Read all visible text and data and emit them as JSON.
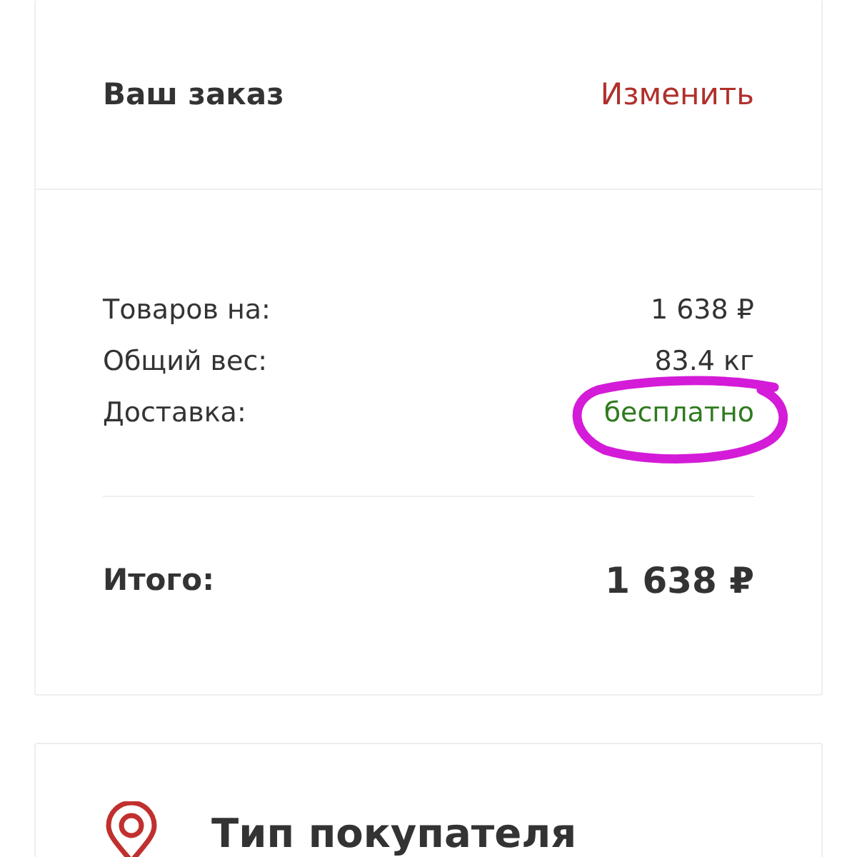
{
  "order_card": {
    "title": "Ваш заказ",
    "edit_link": "Изменить",
    "lines": [
      {
        "label": "Товаров на:",
        "value": "1 638 ₽",
        "kind": "plain",
        "highlighted": false
      },
      {
        "label": "Общий вес:",
        "value": "83.4 кг",
        "kind": "plain",
        "highlighted": false
      },
      {
        "label": "Доставка:",
        "value": "бесплатно",
        "kind": "free",
        "highlighted": true
      }
    ],
    "total": {
      "label": "Итого:",
      "value": "1 638 ₽"
    }
  },
  "buyer_card": {
    "title": "Тип покупателя"
  }
}
